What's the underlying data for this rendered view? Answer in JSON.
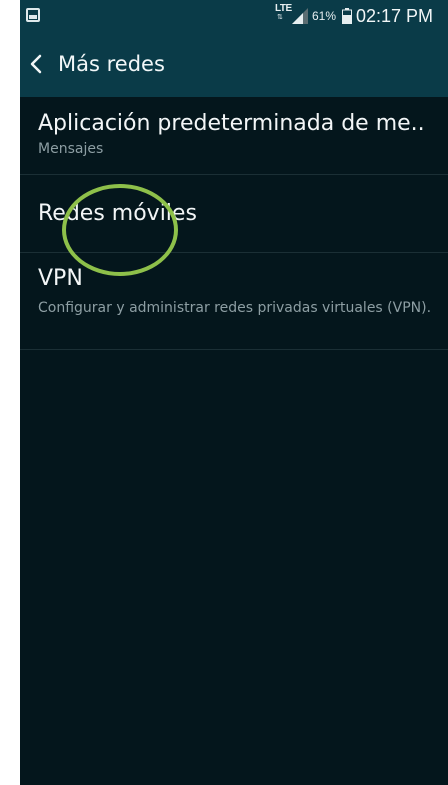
{
  "status_bar": {
    "network": "LTE",
    "battery": "61%",
    "time": "02:17 PM",
    "icons": [
      "gallery-icon",
      "lte-icon",
      "signal-icon",
      "battery-icon"
    ]
  },
  "header": {
    "title": "Más redes",
    "back_icon": "chevron-left-icon"
  },
  "settings": {
    "items": [
      {
        "title": "Aplicación predeterminada de me..",
        "subtitle": "Mensajes"
      },
      {
        "title": "Redes móviles",
        "subtitle": ""
      },
      {
        "title": "VPN",
        "subtitle": "Configurar y administrar redes privadas virtuales (VPN)."
      }
    ]
  },
  "colors": {
    "bar": "#0a3b48",
    "background": "#04161c",
    "touch_indicator": "#8ec04a"
  }
}
